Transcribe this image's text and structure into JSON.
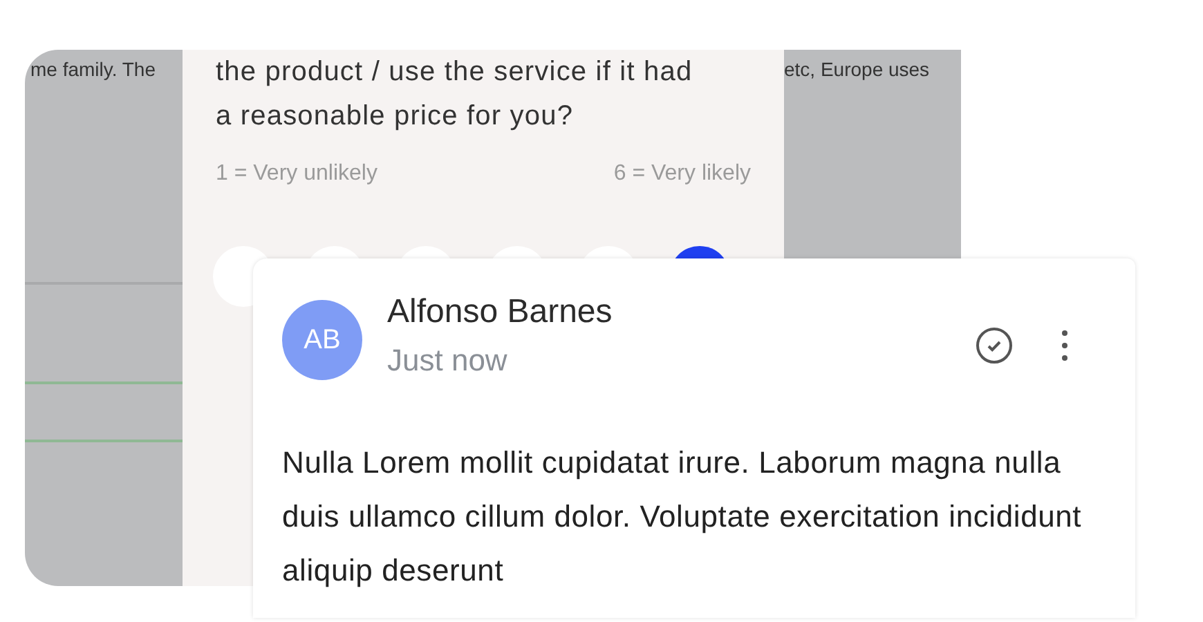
{
  "background_page": {
    "text_left": "me family. The",
    "text_right": "etc, Europe uses"
  },
  "survey": {
    "question": "the product / use the service if it had a reasonable price for you?",
    "min_label": "1 = Very unlikely",
    "max_label": "6 = Very likely",
    "scale": [
      {
        "selected": false
      },
      {
        "selected": false
      },
      {
        "selected": false
      },
      {
        "selected": false
      },
      {
        "selected": false
      },
      {
        "selected": true
      }
    ]
  },
  "comment": {
    "avatar_initials": "AB",
    "author": "Alfonso Barnes",
    "time": "Just now",
    "resolved": false,
    "body": "Nulla Lorem mollit cupidatat irure. Laborum magna nulla duis ullamco cillum dolor. Voluptate exercitation incididunt aliquip deserunt"
  }
}
